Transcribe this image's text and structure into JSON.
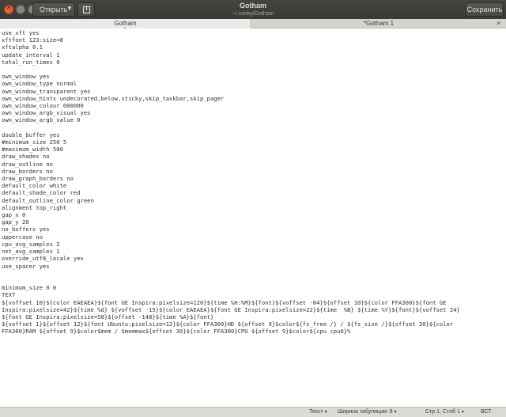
{
  "window": {
    "title": "Gotham",
    "subtitle": "~/.conky/Gotham"
  },
  "toolbar": {
    "open_label": "Открыть",
    "save_label": "Сохранить"
  },
  "tabs": [
    {
      "label": "Gotham",
      "active": true
    },
    {
      "label": "*Gotham 1",
      "active": false
    }
  ],
  "editor": {
    "lines": [
      "use_xft yes",
      "xftfont 123:size=8",
      "xftalpha 0.1",
      "update_interval 1",
      "total_run_times 0",
      "",
      "own_window yes",
      "own_window_type normal",
      "own_window_transparent yes",
      "own_window_hints undecorated,below,sticky,skip_taskbar,skip_pager",
      "own_window_colour 000000",
      "own_window_argb_visual yes",
      "own_window_argb_value 0",
      "",
      "double_buffer yes",
      "#minimum_size 250 5",
      "#maximum_width 500",
      "draw_shades no",
      "draw_outline no",
      "draw_borders no",
      "draw_graph_borders no",
      "default_color white",
      "default_shade_color red",
      "default_outline_color green",
      "alignment top_right",
      "gap_x 0",
      "gap_y 20",
      "no_buffers yes",
      "uppercase no",
      "cpu_avg_samples 2",
      "net_avg_samples 1",
      "override_utf8_locale yes",
      "use_spacer yes",
      "",
      "",
      "minimum_size 0 0",
      "TEXT",
      "${voffset 10}${color EAEAEA}${font GE Inspira:pixelsize=120}${time %H:%M}${font}${voffset -84}${offset 10}${color FFA300}${font GE",
      "Inspira:pixelsize=42}${time %d} ${voffset -15}${color EAEAEA}${font GE Inspira:pixelsize=22}${time  %B} ${time %Y}${font}${voffset 24}",
      "${font GE Inspira:pixelsize=58}${offset -148}${time %A}${font}",
      "${voffset 1}${offset 12}${font Ubuntu:pixelsize=12}${color FFA300}HD ${offset 9}$color${fs_free /} / ${fs_size /}${offset 30}${color",
      "FFA300}RAM ${offset 9}$color$mem / $memmax${offset 30}${color FFA300}CPU ${offset 9}$color${cpu cpu0}%"
    ]
  },
  "statusbar": {
    "syntax": "Текст",
    "tab_width": "Ширина табуляции: 8",
    "position": "Стр 1, Стлб 1",
    "mode": "ВСТ"
  }
}
